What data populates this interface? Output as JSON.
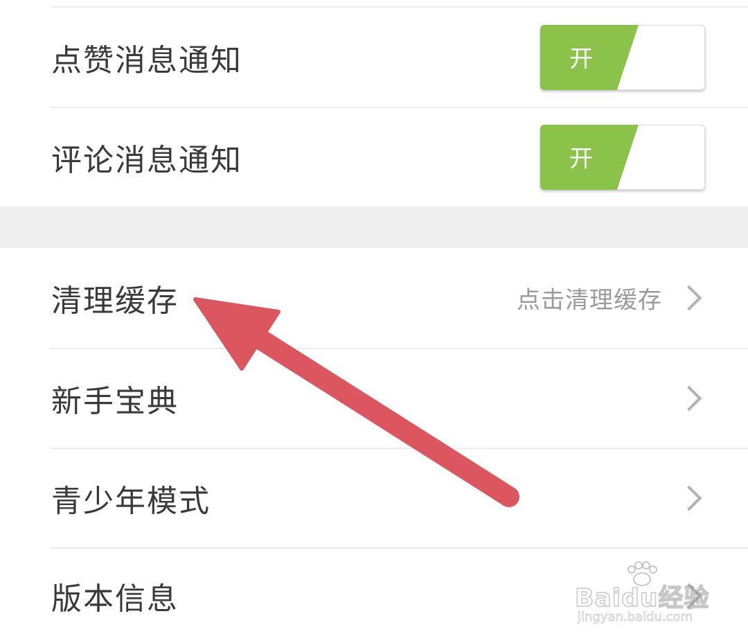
{
  "settings": {
    "notifications": [
      {
        "label": "点赞消息通知",
        "toggle_text": "开",
        "state": "on"
      },
      {
        "label": "评论消息通知",
        "toggle_text": "开",
        "state": "on"
      }
    ],
    "items": [
      {
        "label": "清理缓存",
        "hint": "点击清理缓存"
      },
      {
        "label": "新手宝典"
      },
      {
        "label": "青少年模式"
      },
      {
        "label": "版本信息"
      }
    ]
  },
  "colors": {
    "toggle_on": "#8bc34a",
    "annotation_arrow": "#dc5660",
    "section_gap": "#efefef",
    "text": "#3a3a3a",
    "hint_text": "#9a9a9a"
  },
  "watermark": {
    "brand": "Baidu经验",
    "url": "jingyan.baidu.com"
  },
  "annotation": {
    "type": "arrow",
    "points_to": "清理缓存"
  }
}
